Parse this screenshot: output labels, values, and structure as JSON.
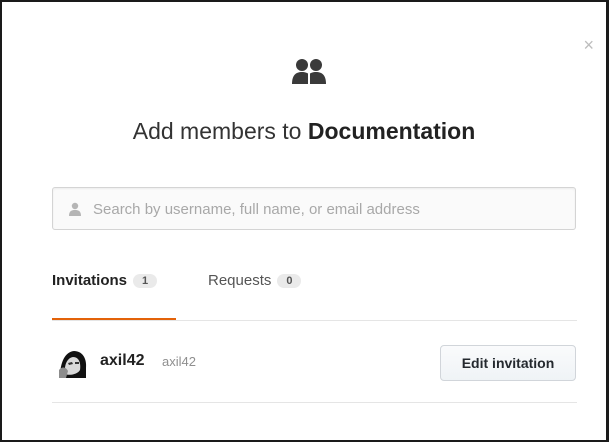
{
  "dialog": {
    "title_prefix": "Add members to ",
    "title_team": "Documentation",
    "close_glyph": "×",
    "header_icon": "people-icon"
  },
  "search": {
    "placeholder": "Search by username, full name, or email address",
    "value": "",
    "icon": "user-icon"
  },
  "tabs": [
    {
      "label": "Invitations",
      "count": "1",
      "active": true
    },
    {
      "label": "Requests",
      "count": "0",
      "active": false
    }
  ],
  "members": [
    {
      "name": "axil42",
      "login": "axil42",
      "action_label": "Edit invitation"
    }
  ],
  "colors": {
    "active_tab_underline": "#e36209",
    "icon_dark": "#3a3a3a"
  }
}
